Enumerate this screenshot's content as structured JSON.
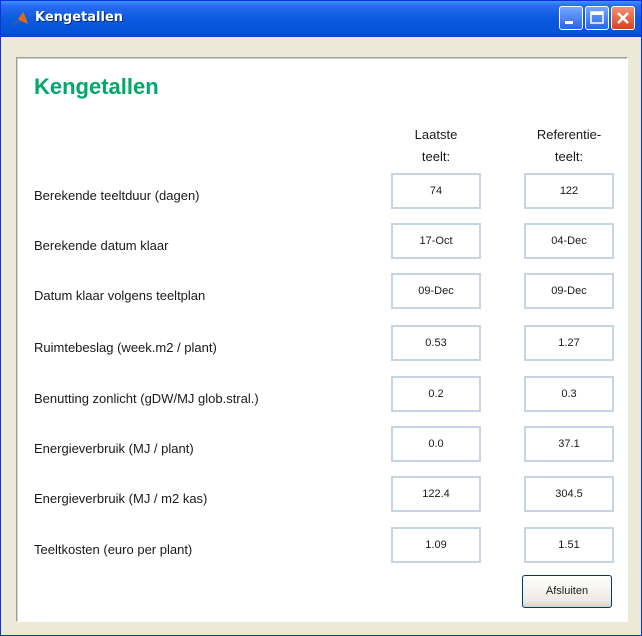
{
  "window": {
    "title": "Kengetallen",
    "controls": {
      "minimize": "minimize-icon",
      "maximize": "maximize-icon",
      "close": "close-icon"
    }
  },
  "panel": {
    "heading": "Kengetallen",
    "heading_color": "#00a86b",
    "columns": [
      {
        "line1": "Laatste",
        "line2": "teelt:"
      },
      {
        "line1": "Referentie-",
        "line2": "teelt:"
      }
    ],
    "rows": [
      {
        "label": "Berekende teeltduur (dagen)",
        "latest": "74",
        "reference": "122"
      },
      {
        "label": "Berekende datum klaar",
        "latest": "17-Oct",
        "reference": "04-Dec"
      },
      {
        "label": "Datum klaar volgens teeltplan",
        "latest": "09-Dec",
        "reference": "09-Dec"
      },
      {
        "label": "Ruimtebeslag (week.m2 / plant)",
        "latest": "0.53",
        "reference": "1.27"
      },
      {
        "label": "Benutting zonlicht (gDW/MJ glob.stral.)",
        "latest": "0.2",
        "reference": "0.3"
      },
      {
        "label": "Energieverbruik (MJ / plant)",
        "latest": "0.0",
        "reference": "37.1"
      },
      {
        "label": "Energieverbruik (MJ / m2 kas)",
        "latest": "122.4",
        "reference": "304.5"
      },
      {
        "label": "Teeltkosten (euro per plant)",
        "latest": "1.09",
        "reference": "1.51"
      }
    ],
    "close_button": "Afsluiten"
  }
}
